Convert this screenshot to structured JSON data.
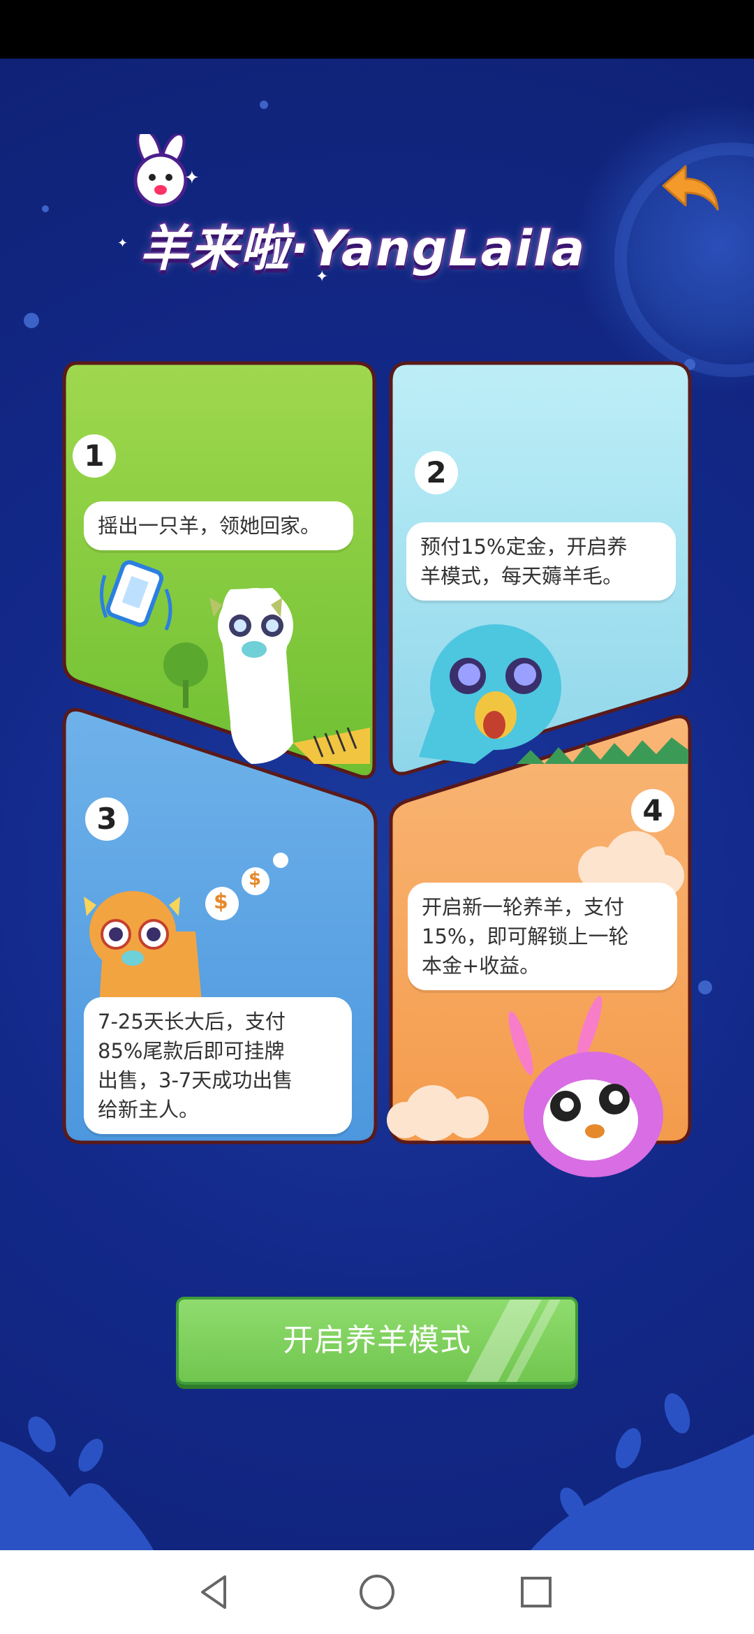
{
  "app": {
    "logo_text_cn": "羊来啦",
    "logo_separator": "·",
    "logo_text_en": "YangLaila"
  },
  "panels": [
    {
      "number": "1",
      "text_lines": [
        "摇出一只羊，领她回家。"
      ],
      "bg": "#8fd24a"
    },
    {
      "number": "2",
      "text_lines": [
        "预付15%定金，开启养",
        "羊模式，每天薅羊毛。"
      ],
      "bg": "#a9e6f2"
    },
    {
      "number": "3",
      "text_lines": [
        "7-25天长大后，支付",
        "85%尾款后即可挂牌",
        "出售，3-7天成功出售",
        "给新主人。"
      ],
      "bg": "#6fb7ec"
    },
    {
      "number": "4",
      "text_lines": [
        "开启新一轮养羊，支付",
        "15%，即可解锁上一轮",
        "本金+收益。"
      ],
      "bg": "#f6a860"
    }
  ],
  "cta": {
    "label": "开启养羊模式"
  },
  "colors": {
    "background": "#13298a",
    "accent_green": "#71c64f",
    "back_arrow": "#f39a2a",
    "panel_border": "#5a1a1a"
  },
  "icons": {
    "back": "back-arrow-icon",
    "nav_back": "triangle-back-icon",
    "nav_home": "circle-home-icon",
    "nav_recent": "square-recent-icon"
  },
  "dollar_sign": "$"
}
